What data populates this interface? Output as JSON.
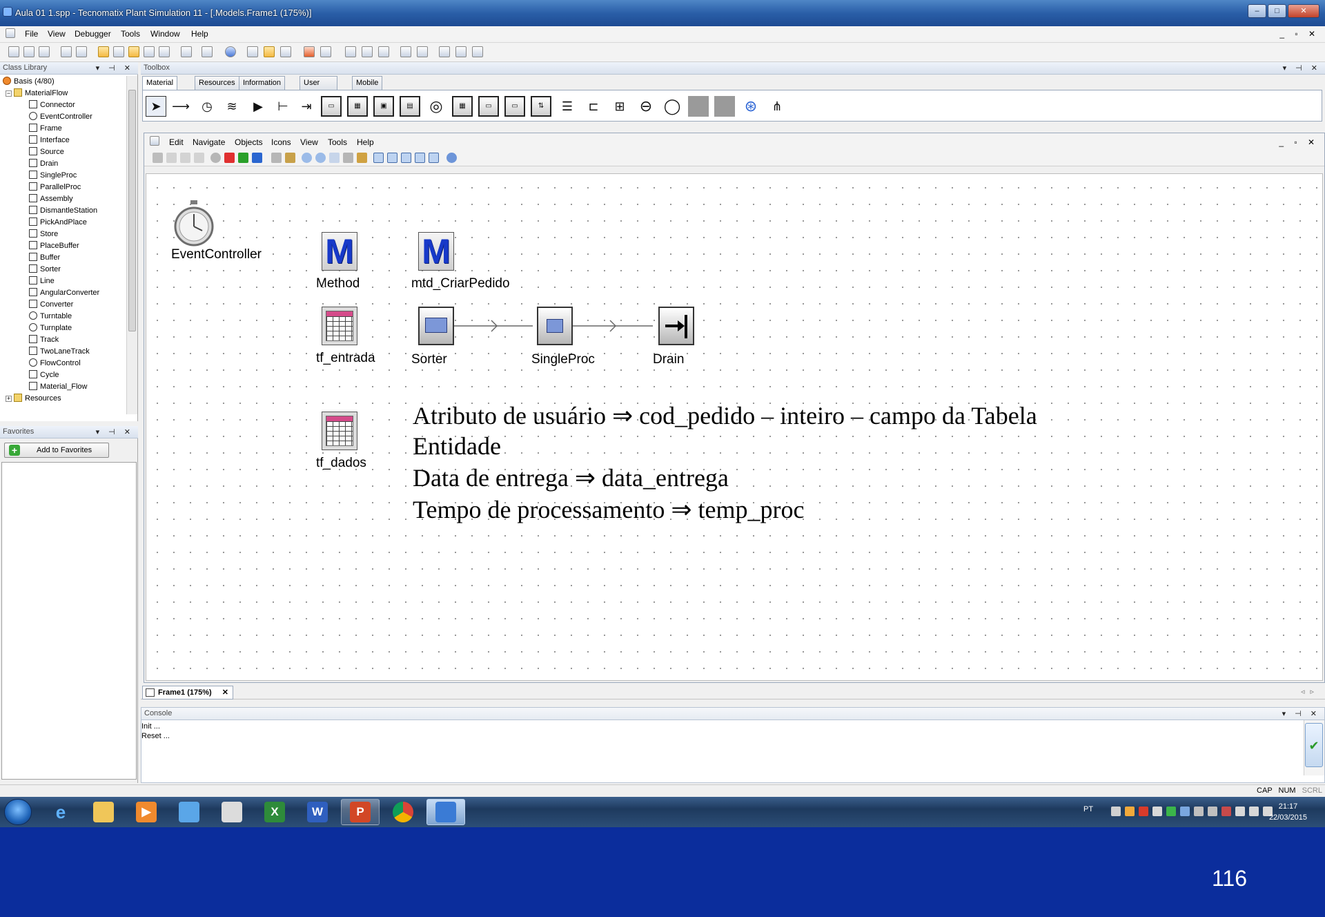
{
  "window": {
    "title": "Aula 01 1.spp - Tecnomatix Plant Simulation 11 - [.Models.Frame1  (175%)]",
    "buttons": [
      "–",
      "□",
      "✕"
    ]
  },
  "menubar": {
    "items": [
      "File",
      "View",
      "Debugger",
      "Tools",
      "Window",
      "Help"
    ],
    "mdi_controls": "_ ▫ ✕"
  },
  "class_library": {
    "title": "Class Library",
    "controls": "▾ ⊣ ✕",
    "root": "Basis (4/80)",
    "folder": "MaterialFlow",
    "items": [
      "Connector",
      "EventController",
      "Frame",
      "Interface",
      "Source",
      "Drain",
      "SingleProc",
      "ParallelProc",
      "Assembly",
      "DismantleStation",
      "PickAndPlace",
      "Store",
      "PlaceBuffer",
      "Buffer",
      "Sorter",
      "Line",
      "AngularConverter",
      "Converter",
      "Turntable",
      "Turnplate",
      "Track",
      "TwoLaneTrack",
      "FlowControl",
      "Cycle",
      "Material_Flow"
    ],
    "next_folder": "Resources"
  },
  "favorites": {
    "title": "Favorites",
    "controls": "▾ ⊣ ✕",
    "add_button": "Add to Favorites"
  },
  "toolbox": {
    "title": "Toolbox",
    "controls": "▾ ⊣ ✕",
    "tabs": [
      "Material Flow",
      "Resources",
      "Information Flow",
      "User Interface",
      "Mobile Units"
    ],
    "active_tab": "Material Flow"
  },
  "frame": {
    "menu": [
      "Edit",
      "Navigate",
      "Objects",
      "Icons",
      "View",
      "Tools",
      "Help"
    ],
    "mdi_controls": "_ ▫ ✕",
    "objects": {
      "event_controller": "EventController",
      "method": "Method",
      "method_icon": "M",
      "mtd": "mtd_CriarPedido",
      "mtd_icon": "M",
      "tf_entrada": "tf_entrada",
      "sorter": "Sorter",
      "singleproc": "SingleProc",
      "drain": "Drain",
      "tf_dados": "tf_dados"
    },
    "notes": {
      "line1": "Atributo de usuário ⇒ cod_pedido – inteiro – campo da Tabela",
      "line2": "Entidade",
      "line3": "Data de entrega ⇒ data_entrega",
      "line4": "Tempo de processamento ⇒ temp_proc"
    }
  },
  "frame_tab": {
    "label": "Frame1  (175%)",
    "close": "✕"
  },
  "console": {
    "title": "Console",
    "controls": "▾ ⊣ ✕",
    "lines": [
      "Init ...",
      "Reset ..."
    ]
  },
  "statusbar": {
    "cap": "CAP",
    "num": "NUM",
    "scrl": "SCRL"
  },
  "taskbar": {
    "language": "PT",
    "time": "21:17",
    "date": "22/03/2015"
  },
  "slide_number": "116",
  "colors": {
    "slide_background": "#0b2d9c",
    "method_icon_blue": "#1739c9",
    "taskbar": "#1e3a5e"
  }
}
